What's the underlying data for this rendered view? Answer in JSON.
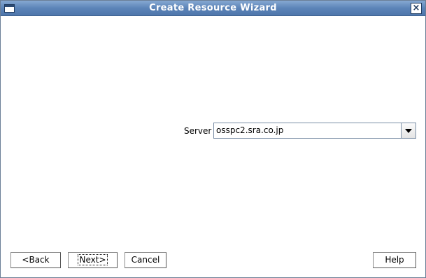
{
  "window": {
    "title": "Create Resource Wizard",
    "close_symbol": "×",
    "icons": {
      "menu": "window-menu-icon",
      "close": "close-icon"
    }
  },
  "form": {
    "server_label": "Server",
    "server_value": "osspc2.sra.co.jp",
    "dropdown_icon": "chevron-down-icon"
  },
  "buttons": {
    "back": "<Back",
    "next": "Next>",
    "cancel": "Cancel",
    "help": "Help"
  },
  "colors": {
    "titlebar": "#5c84b8",
    "title_text": "#ffffff",
    "background": "#ffffff"
  }
}
